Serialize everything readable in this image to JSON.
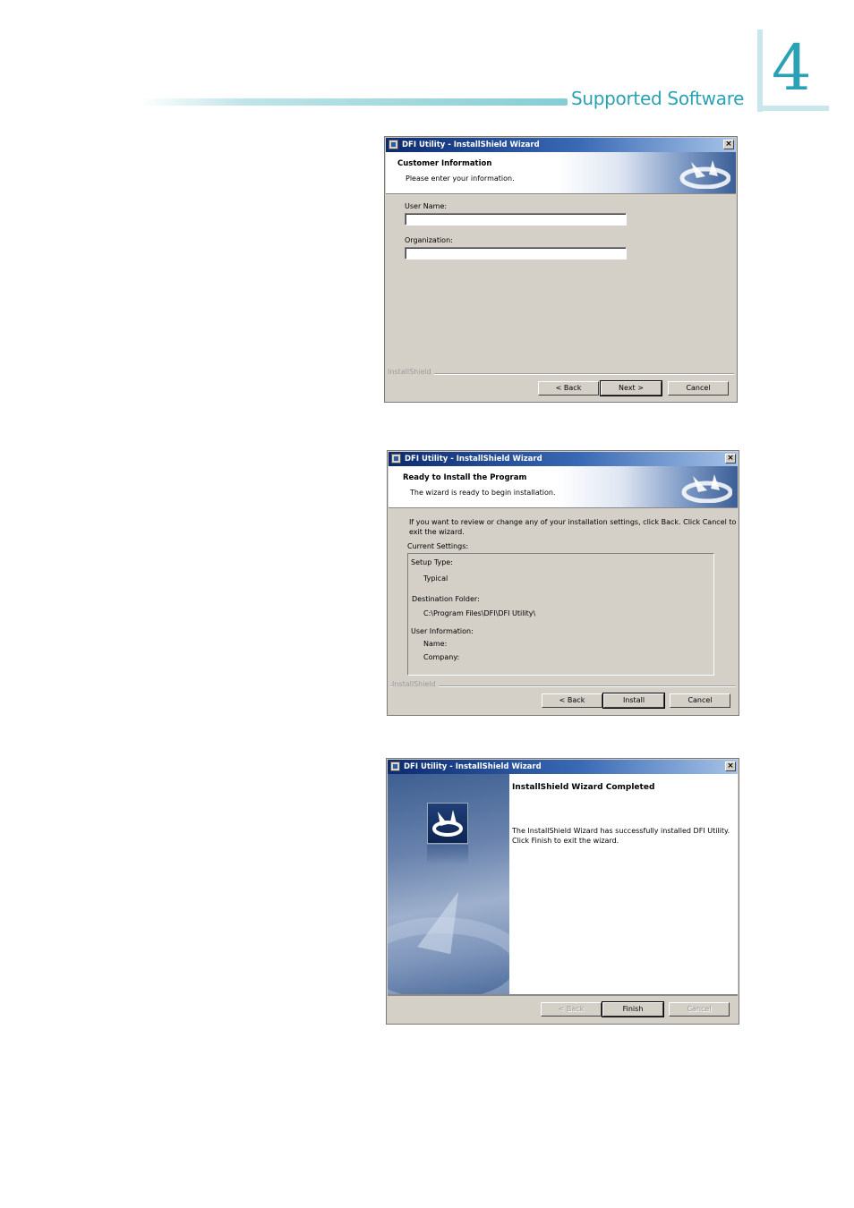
{
  "header": {
    "section_title": "Supported Software",
    "chapter_number": "4"
  },
  "dialog1": {
    "title": "DFI Utility - InstallShield Wizard",
    "heading": "Customer Information",
    "subheading": "Please enter your information.",
    "user_name_label": "User Name:",
    "user_name_value": "",
    "organization_label": "Organization:",
    "organization_value": "",
    "brand": "InstallShield",
    "back": "< Back",
    "next": "Next >",
    "cancel": "Cancel"
  },
  "dialog2": {
    "title": "DFI Utility - InstallShield Wizard",
    "heading": "Ready to Install the Program",
    "subheading": "The wizard is ready to begin installation.",
    "intro_line1": "If you want to review or change any of your installation settings, click Back. Click Cancel to",
    "intro_line2": "exit the wizard.",
    "current_settings": "Current Settings:",
    "setup_type_label": "Setup Type:",
    "setup_type_value": "Typical",
    "dest_folder_label": "Destination Folder:",
    "dest_folder_value": "C:\\Program Files\\DFI\\DFI Utility\\",
    "user_info_label": "User Information:",
    "name_label": "Name:",
    "company_label": "Company:",
    "brand": "InstallShield",
    "back": "< Back",
    "install": "Install",
    "cancel": "Cancel"
  },
  "dialog3": {
    "title": "DFI Utility - InstallShield Wizard",
    "heading": "InstallShield Wizard Completed",
    "message_line1": "The InstallShield Wizard has successfully installed DFI Utility.",
    "message_line2": "Click Finish to exit the wizard.",
    "back": "< Back",
    "finish": "Finish",
    "cancel": "Cancel"
  },
  "colors": {
    "accent": "#2aa1b4",
    "title_bar": "#0b2a6f",
    "dialog_face": "#d4d0c8"
  },
  "icons": [
    "installshield-logo-icon",
    "close-icon",
    "app-icon"
  ]
}
